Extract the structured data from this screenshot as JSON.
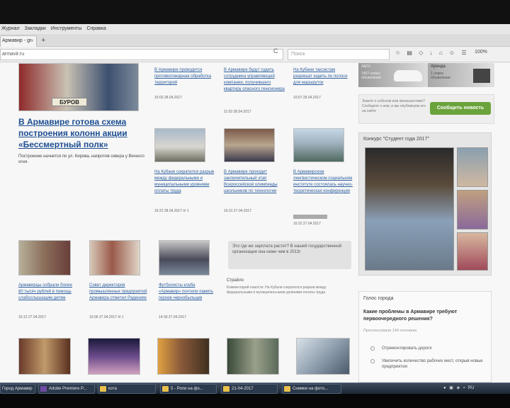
{
  "browser": {
    "menu": [
      "Журнал",
      "Закладки",
      "Инструменты",
      "Справка"
    ],
    "tab_title": "Армавир - gr",
    "tab_close": "×",
    "tab_new": "+",
    "url": "armavir.ru",
    "reload": "C",
    "search_placeholder": "Поиск",
    "zoom": "100%"
  },
  "main": {
    "headline": "В Армавире готова схема построения колонн акции «Бессмертный полк»",
    "lead": "Построение начнется по ул. Кирова, напротив сквера у Вечного огня.",
    "thumb_text": "БУРОВ",
    "news_top": [
      {
        "title": "В Армавире проводится противопожарная обработка территорий",
        "meta": "15:03 28.04.2017"
      },
      {
        "title": "В Армавире будут судить сотрудника управляющей компании, получившего квартиру опасного пенсионера",
        "meta": "11:03 28.04.2017"
      },
      {
        "title": "На Кубани таксистам разрешат ездить по полосе для маршруток",
        "meta": "10:07 28.04.2017"
      }
    ],
    "news_mid": [
      {
        "title": "На Кубани сократился разрыв между федеральными и муниципальными уровнями оплаты труда",
        "meta": "16:22 28.04.2017",
        "comments": "1"
      },
      {
        "title": "В Армавире проходит заключительный этап Всероссийской олимпиады школьников по технологии",
        "meta": "16:31 27.04.2017"
      },
      {
        "title": "В Армавирском лингвистическом социальном институте состоялась научно-теоретическая конференция",
        "meta": "16:22 27.04.2017"
      }
    ],
    "news_low": [
      {
        "title": "Армавирцы собрали более 80 тысяч рублей в помощь слабослышащим детям",
        "meta": "16:12 27.04.2017"
      },
      {
        "title": "Совет директоров промышленных предприятий Армавира отметил Радениях",
        "meta": "15:06 27.04.2017",
        "comments": "1"
      },
      {
        "title": "Футболисты клуба «Армавир» почтили память героев-чернобыльцев",
        "meta": "14:39 27.04.2017"
      }
    ],
    "quote": "Это где же зарплата растет? В нашей государственной организации она ниже чем в 2013г",
    "quote_source": "Страйло",
    "quote_text": "Комментарий новости: На Кубани сократился разрыв между федеральными и муниципальными уровнями оплаты труда"
  },
  "sidebar": {
    "ad1": "Авто",
    "ad1_sub": "1467 новых объявлений",
    "ad2": "Аренда",
    "ad2_sub": "1 новое объявление",
    "report_text": "Знаете о событии или происшествии? Сообщите о нем, и мы опубликуем его на сайте",
    "report_button": "Сообщить новость",
    "contest_title": "Конкурс \"Студент года 2017\"",
    "poll_title": "Голос города",
    "poll_question": "Какие проблемы в Армавире требуют первоочередного решения?",
    "poll_voted": "Проголосовали 144 человека",
    "poll_options": [
      "Отремонтировать дороги",
      "Увеличить количество рабочих мест, открыв новые предприятия"
    ]
  },
  "taskbar": {
    "items": [
      "Город Армавир",
      "Adobe Premiere P...",
      "кота",
      "5 - Роли на фо...",
      "21-04-2017",
      "Снимки на фото..."
    ],
    "lang": "RU"
  }
}
